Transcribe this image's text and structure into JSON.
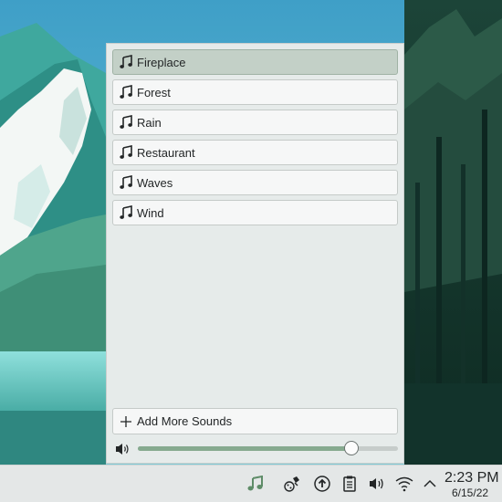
{
  "sounds": [
    {
      "label": "Fireplace",
      "selected": true
    },
    {
      "label": "Forest",
      "selected": false
    },
    {
      "label": "Rain",
      "selected": false
    },
    {
      "label": "Restaurant",
      "selected": false
    },
    {
      "label": "Waves",
      "selected": false
    },
    {
      "label": "Wind",
      "selected": false
    }
  ],
  "add_more_label": "Add More Sounds",
  "volume": {
    "value": 0.82
  },
  "clock": {
    "time": "2:23 PM",
    "date": "6/15/22"
  },
  "tray_icons": [
    "ambient-sound-icon",
    "kde-connect-icon",
    "updates-icon",
    "clipboard-icon",
    "volume-icon",
    "network-icon",
    "expand-arrow-icon"
  ],
  "colors": {
    "selected_item": "#c3d0c7",
    "accent_green": "#86aa8f",
    "tray_music": "#5e8c68"
  }
}
